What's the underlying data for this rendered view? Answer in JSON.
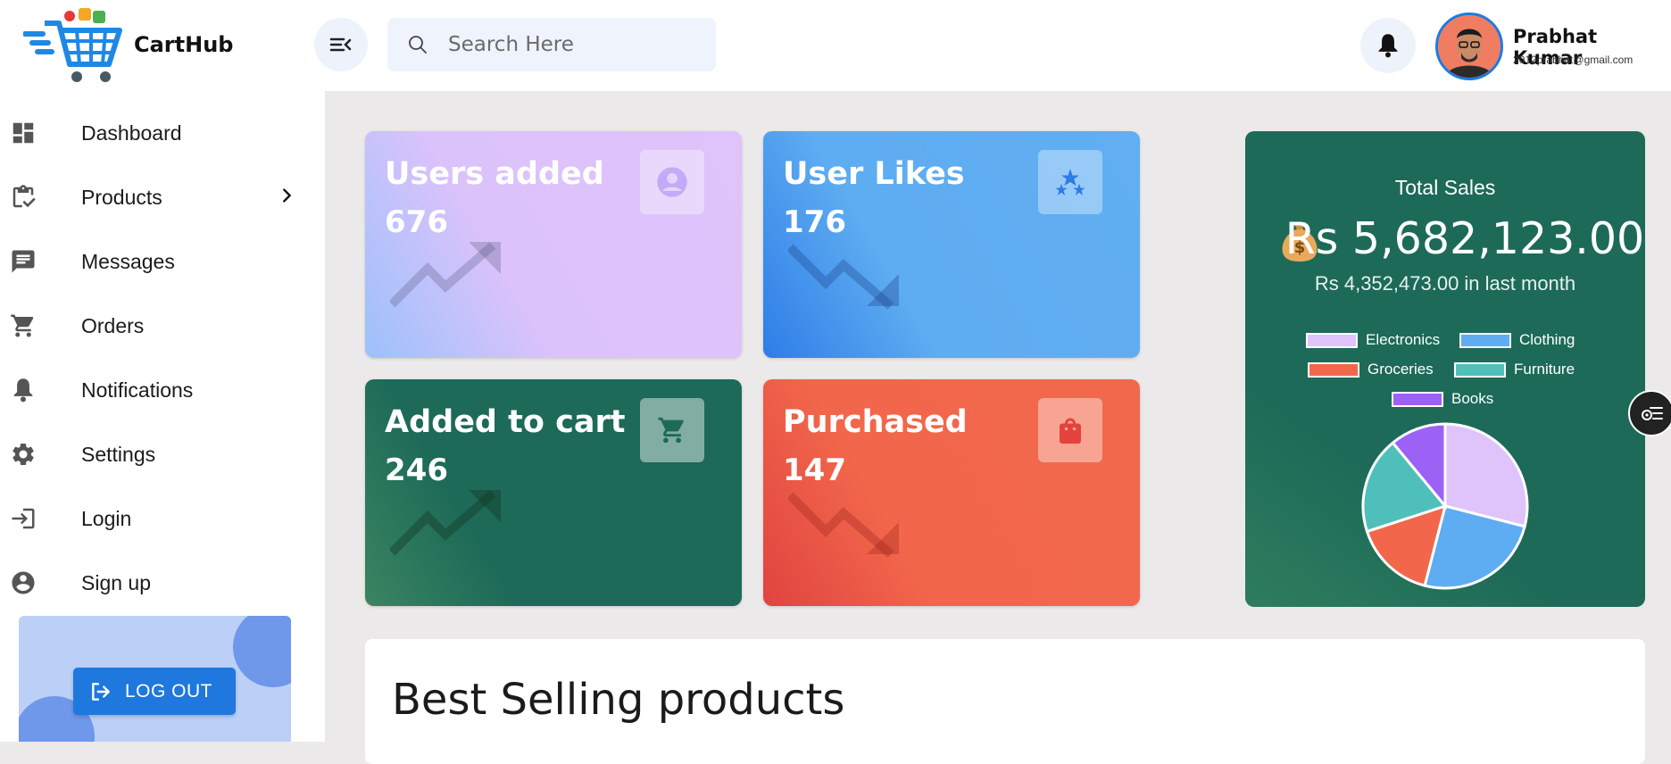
{
  "brand": {
    "name": "CartHub",
    "logo_icon": "cart-logo-icon"
  },
  "header": {
    "search_placeholder": "Search Here",
    "user": {
      "name": "Prabhat Kumar",
      "email": "2012prabhat@gmail.com"
    }
  },
  "sidebar": {
    "items": [
      {
        "label": "Dashboard",
        "icon": "dashboard-icon"
      },
      {
        "label": "Products",
        "icon": "clipboard-check-icon",
        "has_submenu": true
      },
      {
        "label": "Messages",
        "icon": "message-icon"
      },
      {
        "label": "Orders",
        "icon": "cart-icon"
      },
      {
        "label": "Notifications",
        "icon": "bell-icon"
      },
      {
        "label": "Settings",
        "icon": "gear-icon"
      },
      {
        "label": "Login",
        "icon": "login-icon"
      },
      {
        "label": "Sign up",
        "icon": "account-circle-icon"
      }
    ],
    "logout_label": "LOG OUT"
  },
  "cards": [
    {
      "title": "Users added",
      "value": "676",
      "icon": "user-icon",
      "trend": "up"
    },
    {
      "title": "User Likes",
      "value": "176",
      "icon": "stars-icon",
      "trend": "down"
    },
    {
      "title": "Added to cart",
      "value": "246",
      "icon": "cart-icon",
      "trend": "up"
    },
    {
      "title": "Purchased",
      "value": "147",
      "icon": "bag-icon",
      "trend": "down"
    }
  ],
  "sales": {
    "title": "Total Sales",
    "amount": "Rs 5,682,123.00",
    "subtitle": "Rs 4,352,473.00 in last month",
    "icon": "money-bag-icon"
  },
  "chart_data": {
    "type": "pie",
    "categories": [
      "Electronics",
      "Clothing",
      "Groceries",
      "Furniture",
      "Books"
    ],
    "values": [
      29,
      25,
      16,
      19,
      11
    ],
    "colors": [
      "#dfc3fb",
      "#5eacf1",
      "#f2674b",
      "#4fc0b9",
      "#9c62f6"
    ],
    "legend": "top"
  },
  "best_selling": {
    "title": "Best Selling products"
  },
  "colors": {
    "accent": "#1f78dd",
    "sidebar_bg": "#ffffff",
    "page_bg": "#ebe9e9"
  }
}
